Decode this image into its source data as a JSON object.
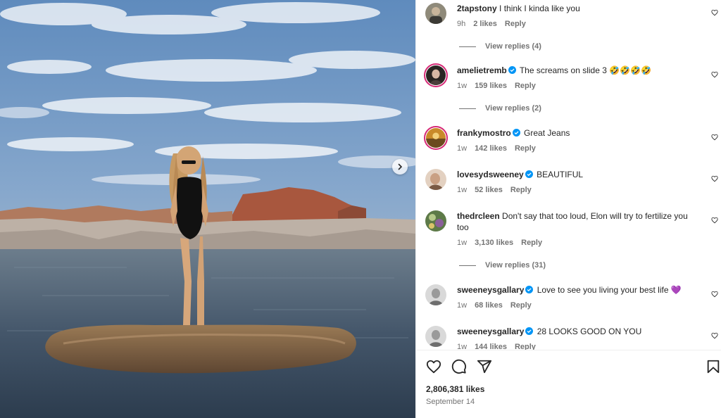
{
  "post": {
    "image_description_icon": "photo-slide",
    "next_icon": "chevron-right-icon"
  },
  "comments": [
    {
      "username": "2tapstony",
      "verified": false,
      "text": "I think I kinda like you",
      "age": "9h",
      "likes": "2 likes",
      "reply": "Reply",
      "view_replies": "View replies (4)"
    },
    {
      "username": "amelietremb",
      "verified": true,
      "text": "The screams on slide 3 🤣🤣🤣🤣",
      "age": "1w",
      "likes": "159 likes",
      "reply": "Reply",
      "view_replies": "View replies (2)"
    },
    {
      "username": "frankymostro",
      "verified": true,
      "text": "Great Jeans",
      "age": "1w",
      "likes": "142 likes",
      "reply": "Reply",
      "view_replies": ""
    },
    {
      "username": "lovesydsweeney",
      "verified": true,
      "text": "BEAUTIFUL",
      "age": "1w",
      "likes": "52 likes",
      "reply": "Reply",
      "view_replies": ""
    },
    {
      "username": "thedrcleen",
      "verified": false,
      "text": "Don't say that too loud, Elon will try to fertilize you too",
      "age": "1w",
      "likes": "3,130 likes",
      "reply": "Reply",
      "view_replies": "View replies (31)"
    },
    {
      "username": "sweeneysgallary",
      "verified": true,
      "text": "Love to see you living your best life 💜",
      "age": "1w",
      "likes": "68 likes",
      "reply": "Reply",
      "view_replies": ""
    },
    {
      "username": "sweeneysgallary",
      "verified": true,
      "text": "28 LOOKS GOOD ON YOU",
      "age": "1w",
      "likes": "144 likes",
      "reply": "Reply",
      "view_replies": ""
    }
  ],
  "actions": {
    "like_icon": "heart-icon",
    "comment_icon": "comment-bubble-icon",
    "share_icon": "paper-plane-icon",
    "save_icon": "bookmark-icon",
    "likes_count": "2,806,381 likes",
    "date": "September 14"
  },
  "colors": {
    "verified": "#0095f6",
    "story_ring": "#d62976",
    "muted_text": "#737373",
    "text": "#262626"
  }
}
